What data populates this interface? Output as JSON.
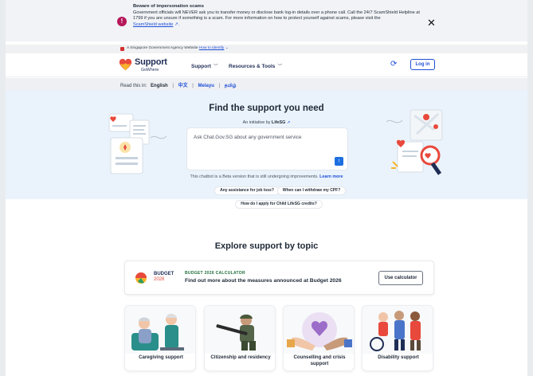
{
  "scam_banner": {
    "title": "Beware of impersonation scams",
    "line1": "Government officials will NEVER ask you to transfer money or disclose bank log-in details over a phone call. Call the 24/7 ScamShield",
    "line2": "Helpline at 1799 if you are unsure if something is a scam. For more information on how to protect yourself against scams, please visit the",
    "link": "ScamShield website",
    "close_icon": "close-icon",
    "alert_icon": "alert-icon"
  },
  "gov_bar": {
    "text": "A Singapore Government Agency Website",
    "link": "How to identify"
  },
  "header": {
    "logo_line1": "Support",
    "logo_line2": "GoWhere",
    "nav": [
      {
        "label": "Support"
      },
      {
        "label": "Resources & Tools"
      }
    ],
    "login_label": "Log in"
  },
  "language_bar": {
    "prefix": "Read this in:",
    "languages": [
      "English",
      "中文",
      "Melayu",
      "தமிழ்"
    ]
  },
  "hero": {
    "title": "Find the support you need",
    "subtitle_prefix": "An initiative by",
    "subtitle_brand": "LifeSG",
    "chat_placeholder": "Ask Chat.Gov.SG about any government service",
    "beta_text": "This chatbot is a Beta version that is still undergoing improvements.",
    "beta_link": "Learn more",
    "suggestions": [
      "Any assistance for job loss?",
      "When can I withdraw my CPF?",
      "How do I apply for Child LifeSG credits?"
    ]
  },
  "explore": {
    "title": "Explore support by topic",
    "budget": {
      "logo_text": "BUDGET",
      "logo_year": "2026",
      "tag": "BUDGET 2026 CALCULATOR",
      "desc": "Find out more about the measures announced at Budget 2026",
      "button": "Use calculator"
    },
    "topics": [
      {
        "label": "Caregiving support"
      },
      {
        "label": "Citizenship and residency"
      },
      {
        "label": "Counselling and crisis support"
      },
      {
        "label": "Disability support"
      }
    ]
  },
  "colors": {
    "primary_blue": "#1d4ed8",
    "hero_bg": "#eaf3fb",
    "alert": "#b5165a"
  }
}
